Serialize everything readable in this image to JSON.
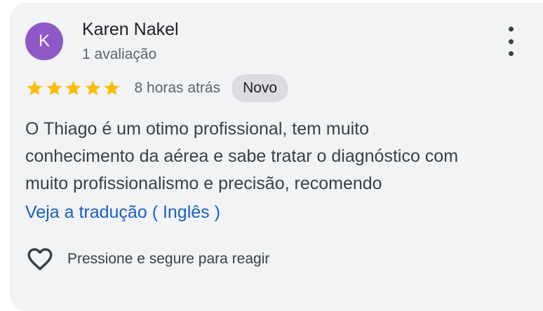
{
  "review": {
    "author": {
      "initial": "K",
      "name": "Karen Nakel",
      "review_count": "1 avaliação",
      "avatar_color": "#8e59c6"
    },
    "menu_icon": "more-vert-icon",
    "rating": {
      "stars": 5,
      "max": 5,
      "star_color": "#fbbc04"
    },
    "time_ago": "8 horas atrás",
    "badge": "Novo",
    "text_lines": [
      "O Thiago é um otimo profissional, tem muito",
      "conhecimento da aérea e sabe tratar o diagnóstico com",
      "muito profissionalismo e precisão, recomendo"
    ],
    "translate_link": "Veja a tradução ( Inglês )",
    "link_color": "#1a5fc8",
    "react_icon": "heart-outline-icon",
    "react_hint": "Pressione e segure para reagir"
  }
}
